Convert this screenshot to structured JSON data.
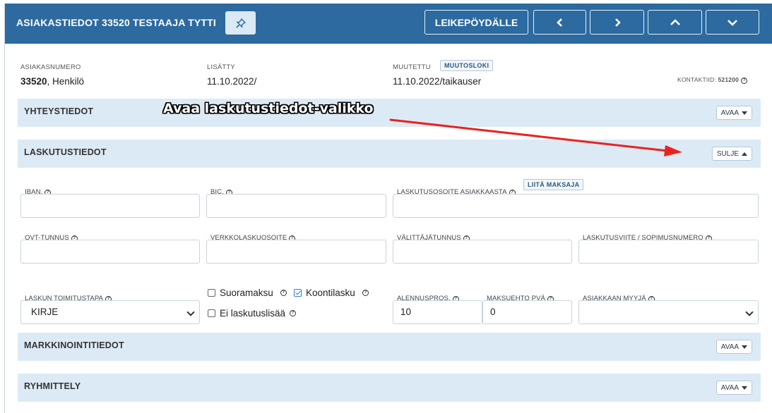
{
  "header": {
    "title": "ASIAKASTIEDOT 33520 TESTAAJA TYTTI",
    "clipboard_label": "LEIKEPÖYDÄLLE",
    "colors": {
      "bar": "#2c6aa0",
      "section": "#dceaf5"
    }
  },
  "meta": {
    "customer_number_label": "ASIAKASNUMERO",
    "customer_number": "33520",
    "customer_type": ", Henkilö",
    "added_label": "LISÄTTY",
    "added_value": "11.10.2022/",
    "modified_label": "MUUTETTU",
    "changelog_label": "MUUTOSLOKI",
    "modified_value": "11.10.2022/taikauser",
    "contact_id_label": "KONTAKTIID:",
    "contact_id_value": "521200"
  },
  "sections": {
    "contact": {
      "title": "YHTEYSTIEDOT",
      "button": "AVAA"
    },
    "billing": {
      "title": "LASKUTUSTIEDOT",
      "button": "SULJE"
    },
    "marketing": {
      "title": "MARKKINOINTITIEDOT",
      "button": "AVAA"
    },
    "grouping": {
      "title": "RYHMITTELY",
      "button": "AVAA"
    }
  },
  "billing": {
    "iban_label": "IBAN.",
    "bic_label": "BIC.",
    "billing_address_label": "LASKUTUSOSOITE ASIAKKAASTA",
    "attach_payer_label": "LIITÄ MAKSAJA",
    "ovt_label": "OVT-TUNNUS",
    "ebilling_address_label": "VERKKOLASKUOSOITE",
    "intermediary_label": "VÄLITTÄJÄTUNNUS",
    "reference_label": "LASKUTUSVIITE / SOPIMUSNUMERO",
    "delivery_method_label": "LASKUN TOIMITUSTAPA",
    "delivery_method_value": "KIRJE",
    "direct_payment_label": "Suoramaksu",
    "consolidated_label": "Koontilasku",
    "no_surcharge_label": "Ei laskutuslisää",
    "discount_label": "ALENNUSPROS.",
    "discount_value": "10",
    "payment_terms_label": "MAKSUEHTO PVÄ",
    "payment_terms_value": "0",
    "seller_label": "ASIAKKAAN MYYJÄ",
    "seller_value": ""
  },
  "annotation": {
    "text": "Avaa laskutustiedot-valikko",
    "arrow_color": "#e8231f"
  }
}
